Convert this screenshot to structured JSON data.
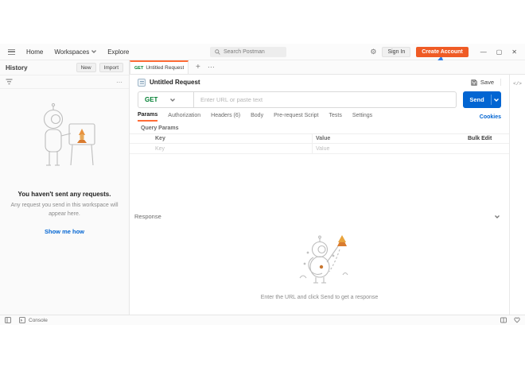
{
  "topbar": {
    "home": "Home",
    "workspaces": "Workspaces",
    "explore": "Explore",
    "search_placeholder": "Search Postman",
    "sign_in": "Sign In",
    "create_account": "Create Account"
  },
  "icons": {
    "minimize": "—",
    "maximize": "▢",
    "close": "✕",
    "gear": "⚙",
    "more": "⋯",
    "plus": "+",
    "code": "</>"
  },
  "sidebar": {
    "title": "History",
    "new_label": "New",
    "import_label": "Import",
    "empty_title": "You haven't sent any requests.",
    "empty_subtitle": "Any request you send in this workspace will appear here.",
    "cta": "Show me how"
  },
  "tab": {
    "method": "GET",
    "title": "Untitled Request"
  },
  "request": {
    "title": "Untitled Request",
    "save_label": "Save",
    "method": "GET",
    "url_placeholder": "Enter URL or paste text",
    "send_label": "Send",
    "tabs": [
      "Params",
      "Authorization",
      "Headers (6)",
      "Body",
      "Pre-request Script",
      "Tests",
      "Settings"
    ],
    "active_tab": "Params",
    "cookies_label": "Cookies",
    "query_params": {
      "section_label": "Query Params",
      "key_header": "Key",
      "value_header": "Value",
      "bulk_edit": "Bulk Edit",
      "key_placeholder": "Key",
      "value_placeholder": "Value"
    }
  },
  "response": {
    "label": "Response",
    "empty_caption": "Enter the URL and click Send to get a response"
  },
  "statusbar": {
    "console_label": "Console"
  },
  "colors": {
    "brand_orange": "#EF5B25",
    "tab_accent_orange": "#FF6C37",
    "send_blue": "#0265D2",
    "link_blue": "#0265D2",
    "method_green": "#007F31",
    "annotation_arrow_blue": "#2B7DE9"
  }
}
